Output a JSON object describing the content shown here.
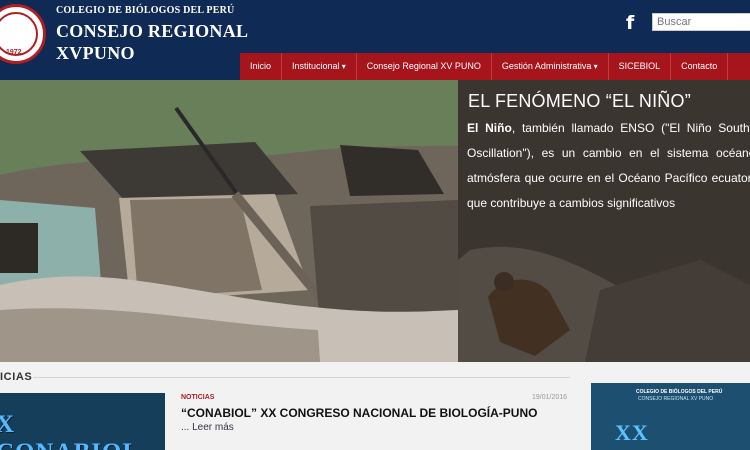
{
  "header": {
    "org_small": "COLEGIO DE BIÓLOGOS DEL PERÚ",
    "org_main_line1": "CONSEJO REGIONAL",
    "org_main_line2": "XVPUNO",
    "logo_year": "1972",
    "facebook_icon": "f",
    "search_placeholder": "Buscar"
  },
  "nav": {
    "items": [
      {
        "label": "Inicio",
        "dropdown": false
      },
      {
        "label": "Institucional",
        "dropdown": true
      },
      {
        "label": "Consejo Regional XV PUNO",
        "dropdown": false
      },
      {
        "label": "Gestión Administrativa",
        "dropdown": true
      },
      {
        "label": "SICEBIOL",
        "dropdown": false
      },
      {
        "label": "Contacto",
        "dropdown": false
      }
    ]
  },
  "hero": {
    "title": "EL FENÓMENO “EL NIÑO”",
    "body_bold": "El Niño",
    "body_rest": ", también llamado ENSO (\"El Niño Southern Oscillation\"), es un cambio en el sistema océano - atmósfera que ocurre en el Océano Pacífico ecuatorial, que contribuye a cambios significativos",
    "dots": 5,
    "active_dot": 5
  },
  "news": {
    "section_title": "ICIAS",
    "thumbnail_text": "X CONABIOL",
    "category": "NOTICIAS",
    "date": "19/01/2016",
    "headline": "“CONABIOL” XX CONGRESO NACIONAL DE BIOLOGÍA-PUNO",
    "read_more": "... Leer más",
    "side_banner_line1": "COLEGIO DE BIÓLOGOS DEL PERÚ",
    "side_banner_line2": "CONSEJO REGIONAL XV PUNO",
    "side_banner_big": "XX CONABIOL"
  },
  "colors": {
    "header": "#0f2a55",
    "nav": "#a5151b",
    "accent": "#b01d22"
  }
}
